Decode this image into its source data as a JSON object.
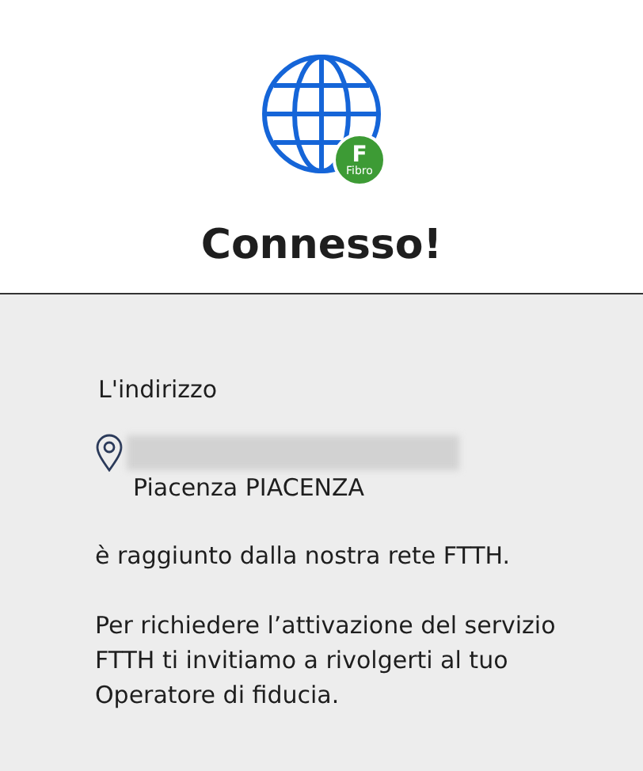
{
  "header": {
    "badge": {
      "letter": "F",
      "label": "Fibro"
    },
    "title": "Connesso!"
  },
  "body": {
    "intro": "L'indirizzo",
    "address": {
      "redacted": true,
      "city": "Piacenza PIACENZA"
    },
    "status": "è raggiunto dalla nostra rete FTTH.",
    "note": "Per richiedere l’attivazione del servizio FTTH ti invitiamo a rivolgerti al tuo Operatore di fiducia."
  }
}
